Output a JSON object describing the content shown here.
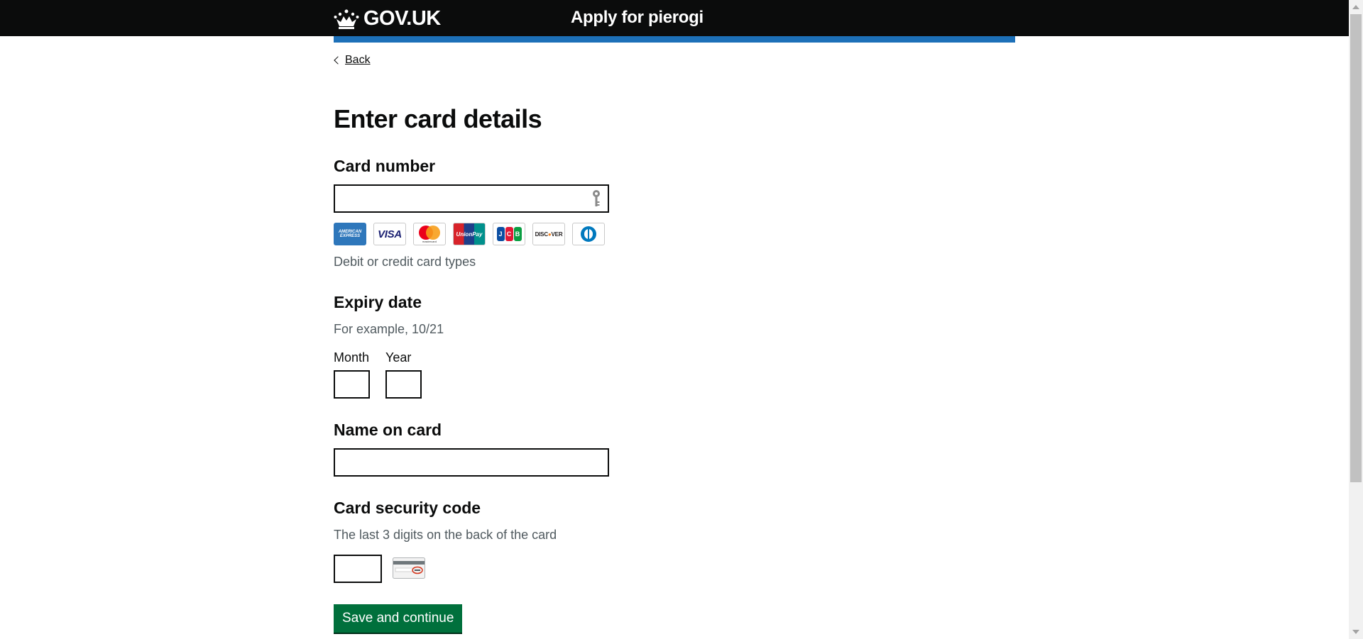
{
  "header": {
    "logo_text": "GOV.UK",
    "service_name": "Apply for pierogi"
  },
  "nav": {
    "back_label": "Back"
  },
  "page": {
    "title": "Enter card details"
  },
  "form": {
    "card_number": {
      "label": "Card number",
      "value": "",
      "hint": "Debit or credit card types",
      "card_types": [
        "American Express",
        "Visa",
        "Mastercard",
        "UnionPay",
        "JCB",
        "Discover",
        "Diners Club"
      ]
    },
    "expiry": {
      "label": "Expiry date",
      "hint": "For example, 10/21",
      "month_label": "Month",
      "year_label": "Year",
      "month_value": "",
      "year_value": ""
    },
    "name_on_card": {
      "label": "Name on card",
      "value": ""
    },
    "security_code": {
      "label": "Card security code",
      "hint": "The last 3 digits on the back of the card",
      "value": ""
    },
    "submit_label": "Save and continue"
  },
  "colors": {
    "header_bg": "#0b0c0c",
    "accent_blue": "#1d70b8",
    "button_green": "#00703c",
    "hint_grey": "#505a5f"
  }
}
